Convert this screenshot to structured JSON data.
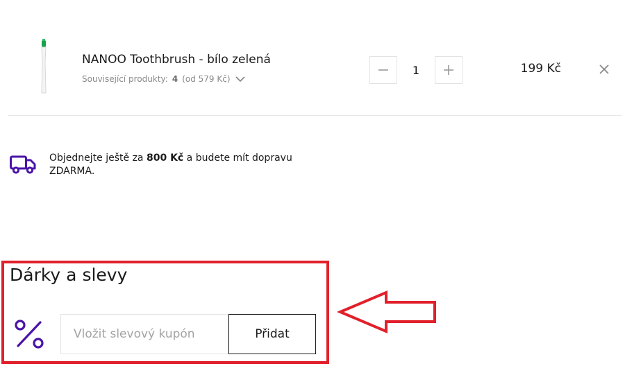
{
  "cart_item": {
    "name": "NANOO Toothbrush - bílo zelená",
    "related_label": "Související produkty:",
    "related_count": "4",
    "related_from": "(od 579 Kč)",
    "quantity": "1",
    "price": "199 Kč",
    "icons": {
      "minus": "minus-icon",
      "plus": "plus-icon",
      "remove": "close-icon",
      "expand": "chevron-down-icon"
    }
  },
  "shipping": {
    "text_before": "Objednejte ještě za",
    "amount": "800 Kč",
    "text_after": "a budete mít dopravu ZDARMA.",
    "icon": "truck-icon"
  },
  "discounts": {
    "title": "Dárky a slevy",
    "coupon_placeholder": "Vložit slevový kupón",
    "coupon_value": "",
    "add_label": "Přidat",
    "icon": "percent-icon"
  },
  "colors": {
    "accent": "#4a14a8",
    "annotation": "#e1202b",
    "brush_head": "#19a24a"
  }
}
